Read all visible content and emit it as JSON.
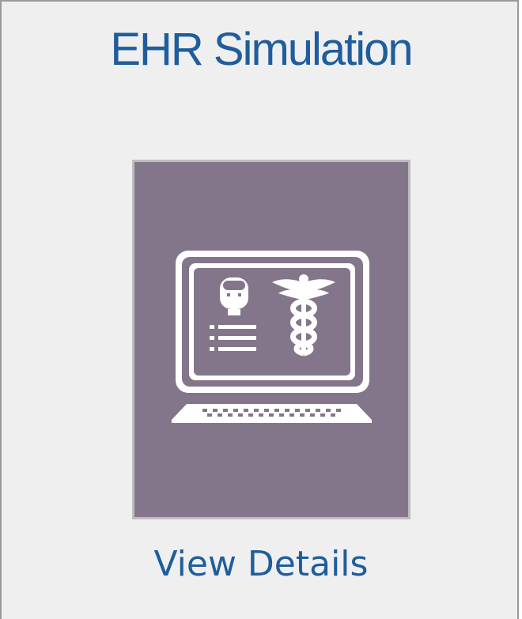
{
  "card": {
    "title": "EHR Simulation",
    "link_label": "View Details",
    "tile_icon": "ehr-computer-icon"
  },
  "colors": {
    "title": "#1f5d9c",
    "link": "#1f5d9c",
    "tile_bg": "#83768b",
    "card_bg": "#efefef",
    "icon": "#ffffff"
  }
}
